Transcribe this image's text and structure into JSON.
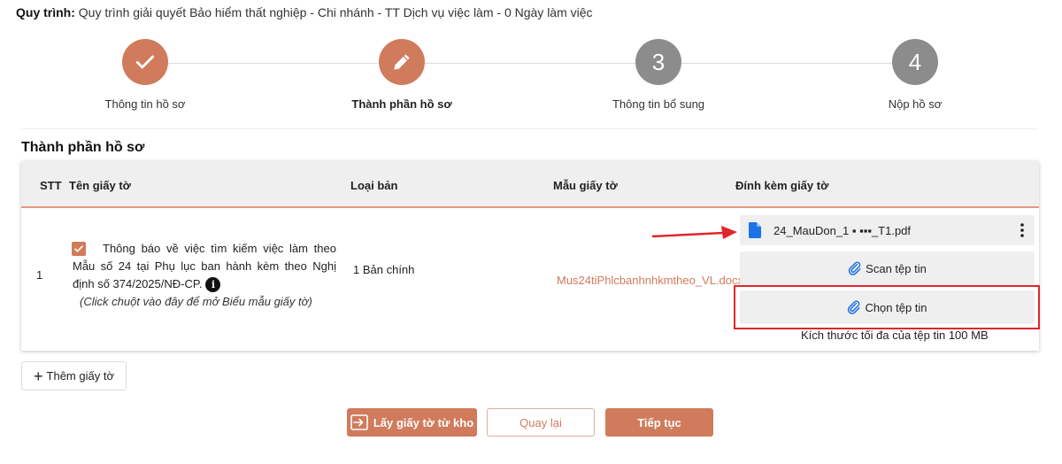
{
  "process": {
    "label": "Quy trình:",
    "value": "Quy trình giải quyết Bảo hiểm thất nghiệp - Chi nhánh - TT Dịch vụ việc làm - 0 Ngày làm việc"
  },
  "steps": [
    {
      "label": "Thông tin hồ sơ",
      "icon": "check-icon",
      "number": ""
    },
    {
      "label": "Thành phần hồ sơ",
      "icon": "pencil-icon",
      "number": ""
    },
    {
      "label": "Thông tin bổ sung",
      "icon": "",
      "number": "3"
    },
    {
      "label": "Nộp hồ sơ",
      "icon": "",
      "number": "4"
    }
  ],
  "section_title": "Thành phần hồ sơ",
  "table": {
    "headers": {
      "stt": "STT",
      "name": "Tên giấy tờ",
      "type": "Loại bản",
      "template": "Mẫu giấy tờ",
      "attach": "Đính kèm giấy tờ"
    },
    "rows": [
      {
        "stt": "1",
        "name": "Thông báo về việc tìm kiếm việc làm theo Mẫu số 24 tại Phụ lục ban hành kèm theo Nghị định số 374/2025/NĐ-CP.",
        "hint": "(Click chuột vào đây để mở Biểu mẫu giấy tờ)",
        "type": "1 Bản chính",
        "template": "Mus24tiPhlcbanhnhkmtheo_VL.docx",
        "file_name": "24_MauDon_1 ▪ ▪▪▪_T1.pdf",
        "scan_label": "Scan tệp tin",
        "choose_label": "Chọn tệp tin",
        "limit": "Kích thước tối đa của tệp tin 100 MB"
      }
    ]
  },
  "add_button": "Thêm giấy tờ",
  "buttons": {
    "get_from_store": "Lấy giấy tờ từ kho",
    "back": "Quay lại",
    "next": "Tiếp tục"
  },
  "colors": {
    "accent": "#d07b5b",
    "highlight": "#e0262b",
    "inactive_step": "#8c8c8c",
    "file_icon": "#1a73e8"
  }
}
